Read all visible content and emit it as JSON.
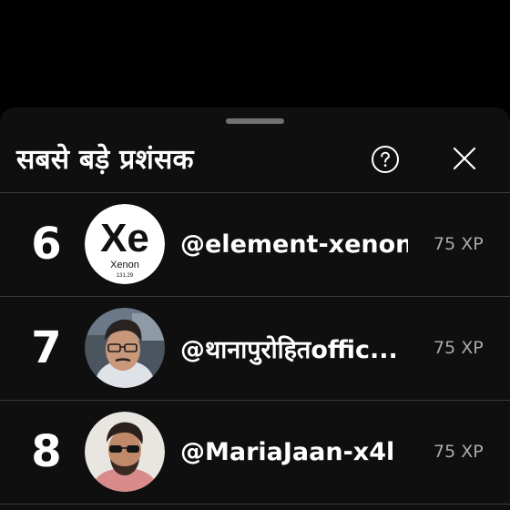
{
  "header": {
    "title": "सबसे बड़े प्रशंसक",
    "help_icon": "question-circle-icon",
    "close_icon": "close-icon"
  },
  "rows": [
    {
      "rank": "6",
      "handle": "@element-xenon",
      "xp": "75 XP",
      "avatar": {
        "type": "element-tile",
        "symbol": "Xe",
        "name": "Xenon",
        "mass": "131.29"
      }
    },
    {
      "rank": "7",
      "handle": "@थानापुरोहितoffic...",
      "xp": "75 XP",
      "avatar": {
        "type": "photo"
      }
    },
    {
      "rank": "8",
      "handle": "@MariaJaan-x4l",
      "xp": "75 XP",
      "avatar": {
        "type": "photo"
      }
    }
  ],
  "colors": {
    "background": "#000000",
    "sheet": "#0f0f0f",
    "text": "#ffffff",
    "muted": "#aaaaaa",
    "divider": "#3a3a3a"
  }
}
